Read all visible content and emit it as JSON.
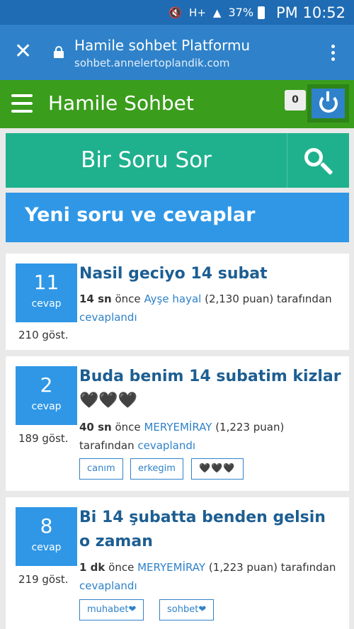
{
  "status_bar": {
    "mute_icon": "mute-icon",
    "network": "H+",
    "signal_icon": "signal-icon",
    "battery": "37%",
    "time": "PM 10:52"
  },
  "browser": {
    "title": "Hamile sohbet Platformu",
    "url": "sohbet.annelertoplandik.com"
  },
  "topbar": {
    "brand": "Hamile Sohbet",
    "notification_count": "0"
  },
  "ask_button": "Bir Soru Sor",
  "section_title": "Yeni soru ve cevaplar",
  "questions": [
    {
      "count": "11",
      "count_label": "cevap",
      "views": "210 göst.",
      "title": "Nasil geciyo 14 subat",
      "time": "14 sn",
      "before": "önce",
      "user": "Ayşe hayal",
      "points": "(2,130 puan)",
      "by": "tarafından",
      "action": "cevaplandı",
      "tags": []
    },
    {
      "count": "2",
      "count_label": "cevap",
      "views": "189 göst.",
      "title": "Buda benim 14 subatim kizlar 🖤🖤🖤",
      "time": "40 sn",
      "before": "önce",
      "user": "MERYEMİRAY",
      "points": "(1,223 puan)",
      "by": "tarafından",
      "action": "cevaplandı",
      "tags": [
        "canım",
        "erkegim",
        "🖤🖤🖤"
      ]
    },
    {
      "count": "8",
      "count_label": "cevap",
      "views": "219 göst.",
      "title": "Bi 14 şubatta benden gelsin o zaman",
      "time": "1 dk",
      "before": "önce",
      "user": "MERYEMİRAY",
      "points": "(1,223 puan)",
      "by": "tarafından",
      "action": "cevaplandı",
      "tags": [
        "muhabet❤",
        "sohbet❤"
      ]
    }
  ]
}
